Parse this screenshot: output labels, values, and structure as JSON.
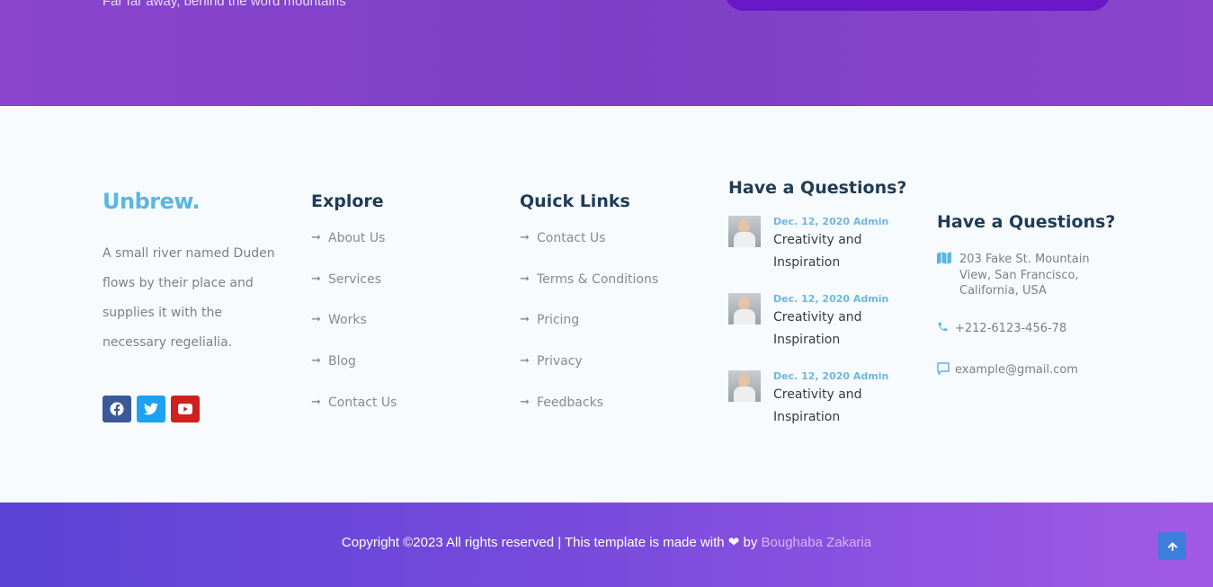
{
  "top": {
    "tagline": "Far far away, behind the word mountains"
  },
  "brand": {
    "logo": "Unbrew.",
    "about": "A small river named Duden flows by their place and supplies it with the necessary regelialia."
  },
  "social": [
    {
      "icon": "facebook-icon"
    },
    {
      "icon": "twitter-icon"
    },
    {
      "icon": "youtube-icon"
    }
  ],
  "explore": {
    "title": "Explore",
    "items": [
      "About Us",
      "Services",
      "Works",
      "Blog",
      "Contact Us"
    ]
  },
  "quick_links": {
    "title": "Quick Links",
    "items": [
      "Contact Us",
      "Terms & Conditions",
      "Pricing",
      "Privacy",
      "Feedbacks"
    ]
  },
  "blog": {
    "title": "Have a Questions?",
    "posts": [
      {
        "meta": "Dec. 12, 2020 Admin",
        "title": "Creativity and Inspiration"
      },
      {
        "meta": "Dec. 12, 2020 Admin",
        "title": "Creativity and Inspiration"
      },
      {
        "meta": "Dec. 12, 2020 Admin",
        "title": "Creativity and Inspiration"
      }
    ]
  },
  "contact": {
    "title": "Have a Questions?",
    "address": "203 Fake St. Mountain View, San Francisco, California, USA",
    "phone": "+212-6123-456-78",
    "email": "example@gmail.com"
  },
  "footer": {
    "copyright": "Copyright ©2023 All rights reserved | This template is made with",
    "by": "by",
    "author": "Boughaba Zakaria"
  },
  "colors": {
    "accent": "#5ab6e4",
    "heading": "#1f3b57",
    "purple_band": "#8a45cc",
    "back_to_top": "#3d7ddb"
  }
}
